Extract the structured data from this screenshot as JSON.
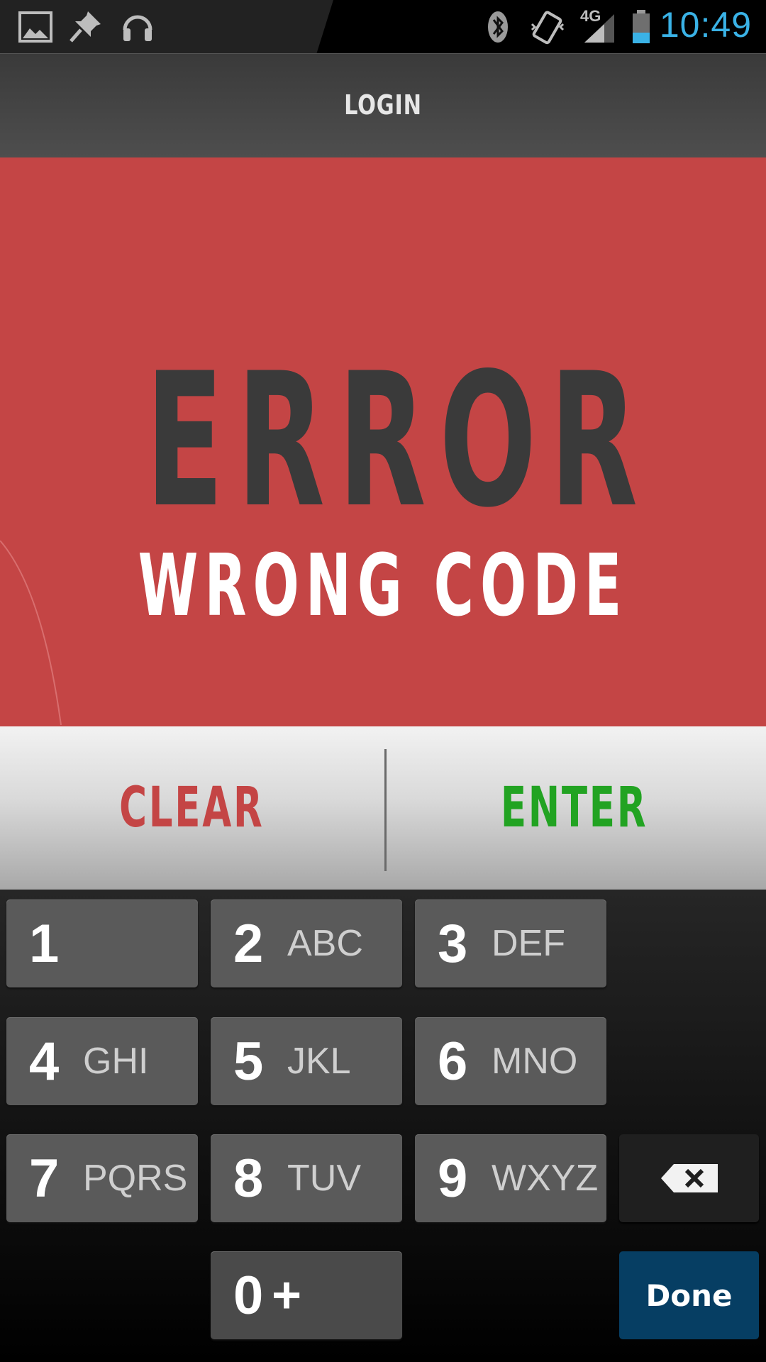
{
  "status_bar": {
    "time": "10:49",
    "network": "4G",
    "icons": [
      "image-icon",
      "pin-icon",
      "headphones-icon",
      "bluetooth-icon",
      "vibrate-icon",
      "signal-icon",
      "battery-icon"
    ]
  },
  "action_bar": {
    "title": "LOGIN"
  },
  "error": {
    "title": "ERROR",
    "message": "WRONG CODE",
    "background": "#c44545"
  },
  "actions": {
    "clear_label": "CLEAR",
    "enter_label": "ENTER",
    "clear_color": "#c44545",
    "enter_color": "#22a322"
  },
  "keypad": {
    "keys": [
      {
        "digit": "1",
        "letters": ""
      },
      {
        "digit": "2",
        "letters": "ABC"
      },
      {
        "digit": "3",
        "letters": "DEF"
      },
      {
        "digit": "4",
        "letters": "GHI"
      },
      {
        "digit": "5",
        "letters": "JKL"
      },
      {
        "digit": "6",
        "letters": "MNO"
      },
      {
        "digit": "7",
        "letters": "PQRS"
      },
      {
        "digit": "8",
        "letters": "TUV"
      },
      {
        "digit": "9",
        "letters": "WXYZ"
      },
      {
        "digit": "0",
        "letters": "+"
      }
    ],
    "done_label": "Done",
    "done_color": "#063e63"
  }
}
